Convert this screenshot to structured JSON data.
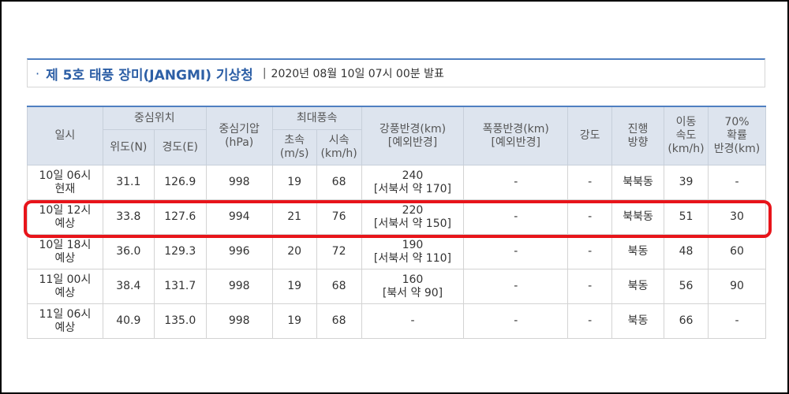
{
  "title": {
    "dot": "·",
    "main": "제 5호 태풍 장미(JANGMI) 기상청",
    "separator": "|",
    "subtitle": "2020년 08월 10일 07시 00분 발표"
  },
  "table": {
    "headers": {
      "datetime": "일시",
      "center_position": "중심위치",
      "latitude": "위도(N)",
      "longitude": "경도(E)",
      "pressure_1": "중심기압",
      "pressure_2": "(hPa)",
      "max_wind": "최대풍속",
      "wind_ms_1": "초속",
      "wind_ms_2": "(m/s)",
      "wind_kmh_1": "시속",
      "wind_kmh_2": "(km/h)",
      "strong_wind_radius_1": "강풍반경(km)",
      "strong_wind_radius_2": "[예외반경]",
      "storm_radius_1": "폭풍반경(km)",
      "storm_radius_2": "[예외반경]",
      "intensity": "강도",
      "direction_1": "진행",
      "direction_2": "방향",
      "speed_1": "이동",
      "speed_2": "속도",
      "speed_3": "(km/h)",
      "prob_radius_1": "70%",
      "prob_radius_2": "확률",
      "prob_radius_3": "반경(km)"
    },
    "rows": [
      {
        "dt1": "10일 06시",
        "dt2": "현재",
        "lat": "31.1",
        "lon": "126.9",
        "pressure": "998",
        "ms": "19",
        "kmh": "68",
        "strong1": "240",
        "strong2": "[서북서 약 170]",
        "storm": "-",
        "intensity": "-",
        "direction": "북북동",
        "speed": "39",
        "prob": "-"
      },
      {
        "dt1": "10일 12시",
        "dt2": "예상",
        "lat": "33.8",
        "lon": "127.6",
        "pressure": "994",
        "ms": "21",
        "kmh": "76",
        "strong1": "220",
        "strong2": "[서북서 약 150]",
        "storm": "-",
        "intensity": "-",
        "direction": "북북동",
        "speed": "51",
        "prob": "30"
      },
      {
        "dt1": "10일 18시",
        "dt2": "예상",
        "lat": "36.0",
        "lon": "129.3",
        "pressure": "996",
        "ms": "20",
        "kmh": "72",
        "strong1": "190",
        "strong2": "[서북서 약 110]",
        "storm": "-",
        "intensity": "-",
        "direction": "북동",
        "speed": "48",
        "prob": "60"
      },
      {
        "dt1": "11일 00시",
        "dt2": "예상",
        "lat": "38.4",
        "lon": "131.7",
        "pressure": "998",
        "ms": "19",
        "kmh": "68",
        "strong1": "160",
        "strong2": "[북서 약 90]",
        "storm": "-",
        "intensity": "-",
        "direction": "북동",
        "speed": "56",
        "prob": "90"
      },
      {
        "dt1": "11일 06시",
        "dt2": "예상",
        "lat": "40.9",
        "lon": "135.0",
        "pressure": "998",
        "ms": "19",
        "kmh": "68",
        "strong1": "-",
        "strong2": "",
        "storm": "-",
        "intensity": "-",
        "direction": "북동",
        "speed": "66",
        "prob": "-"
      }
    ]
  },
  "colors": {
    "title_blue": "#2d5fa6",
    "header_bg": "#dde4ee",
    "highlight_red": "#e8141a"
  },
  "highlighted_row": 1
}
